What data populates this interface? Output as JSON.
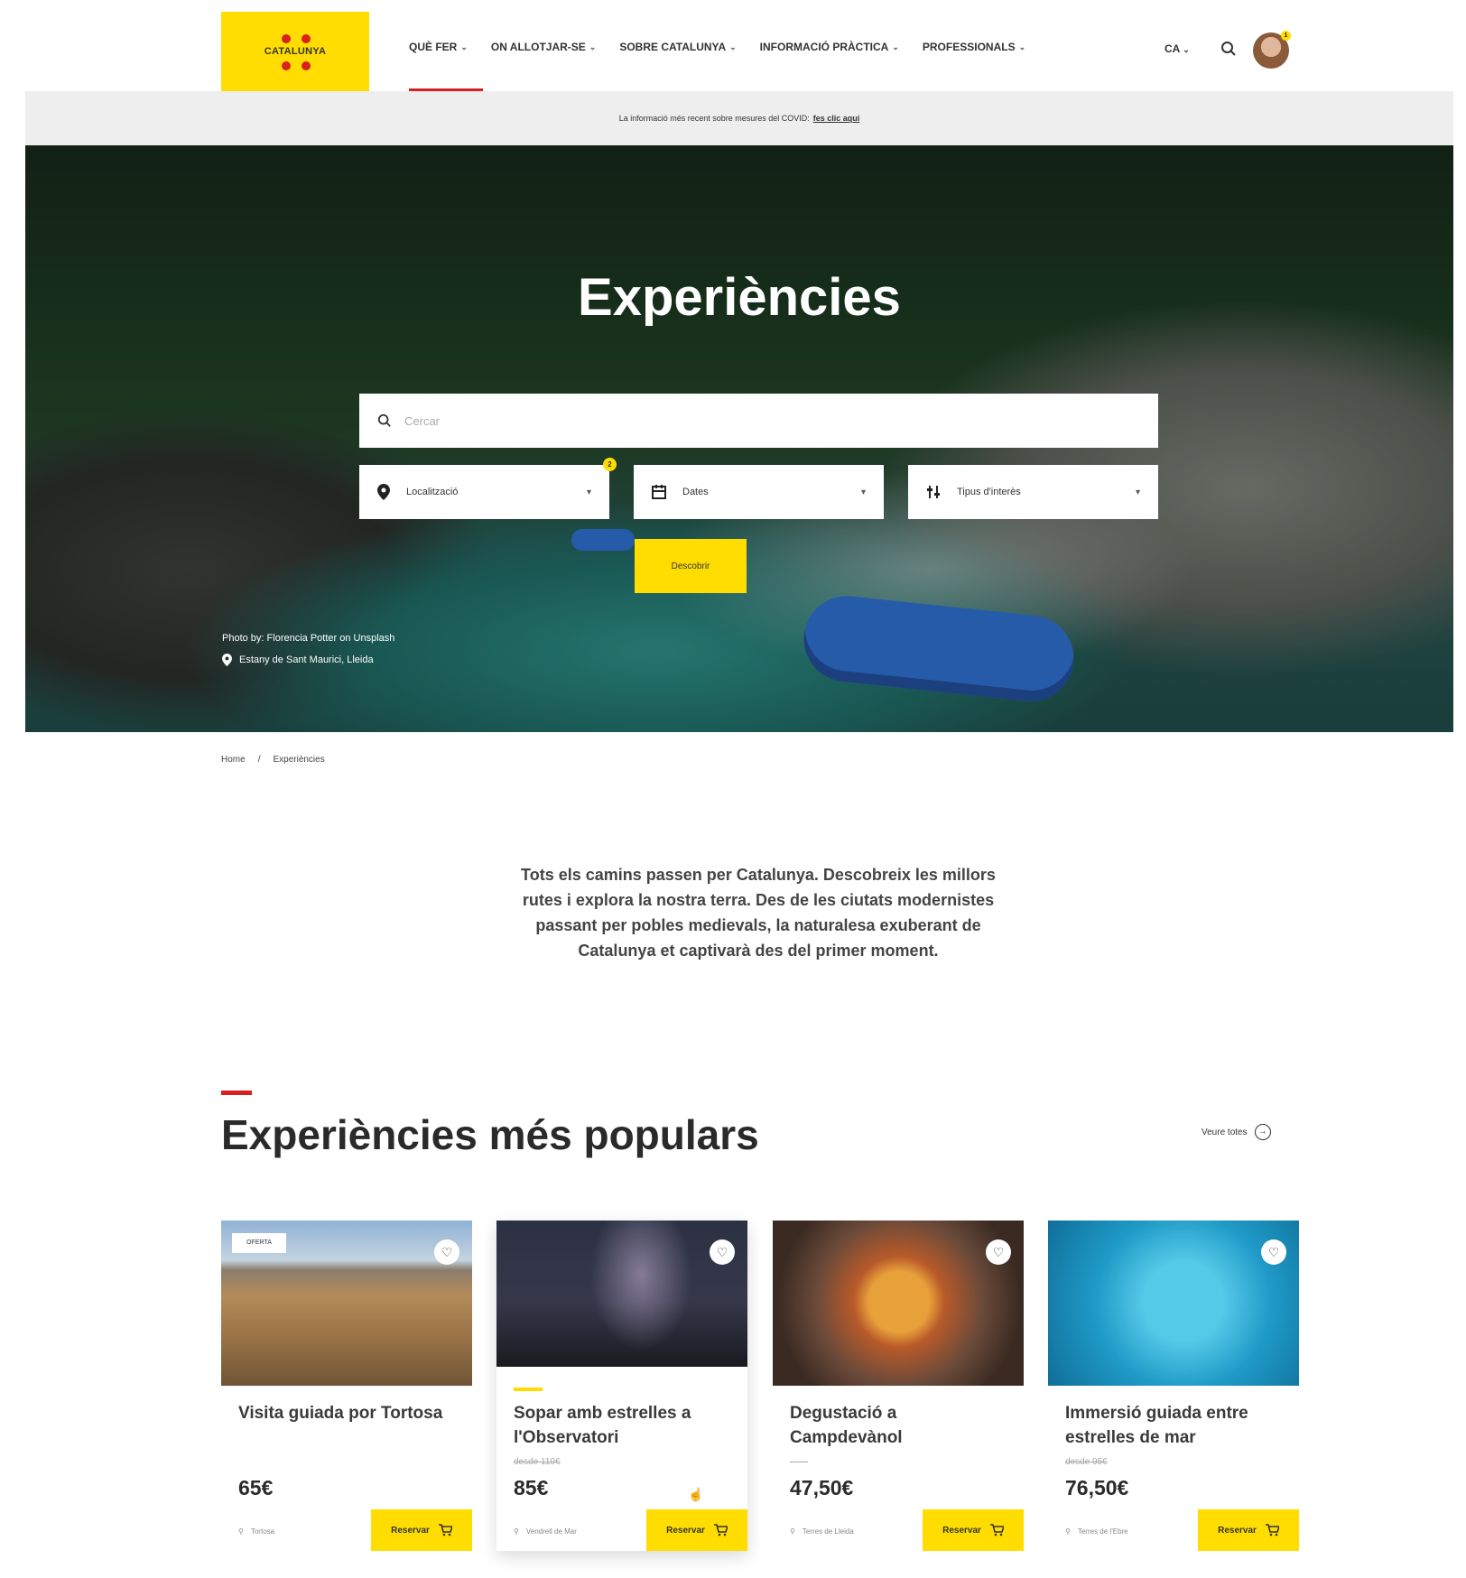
{
  "header": {
    "logo_text": "CATALUNYA",
    "nav": [
      {
        "label": "QUÈ FER"
      },
      {
        "label": "ON ALLOTJAR-SE"
      },
      {
        "label": "SOBRE CATALUNYA"
      },
      {
        "label": "INFORMACIÓ PRÀCTICA"
      },
      {
        "label": "PROFESSIONALS"
      }
    ],
    "lang": "CA",
    "avatar_badge": "1"
  },
  "notice": {
    "text": "La informació més recent sobre mesures del COVID:",
    "link": "fes clic aquí"
  },
  "hero": {
    "title": "Experiències",
    "search_placeholder": "Cercar",
    "filters": [
      {
        "label": "Localització",
        "icon": "pin-icon"
      },
      {
        "label": "Dates",
        "icon": "calendar-icon"
      },
      {
        "label": "Tipus d'interès",
        "icon": "sliders-icon"
      }
    ],
    "filter_badge": "2",
    "discover_label": "Descobrir",
    "credit": "Photo by: Florencia Potter on Unsplash",
    "place": "Estany de Sant Maurici, Lleida"
  },
  "breadcrumb": {
    "home": "Home",
    "separator": "/",
    "current": "Experiències"
  },
  "intro": "Tots els camins passen per Catalunya. Descobreix les millors rutes i explora la nostra terra. Des de les ciutats modernistes passant per pobles medievals, la naturalesa exuberant de Catalunya et captivarà des del primer moment.",
  "section": {
    "title": "Experiències més populars",
    "see_all": "Veure totes"
  },
  "cards": [
    {
      "title": "Visita guiada por Tortosa",
      "old_price": "",
      "price": "65€",
      "location": "Tortosa",
      "tag": "OFERTA",
      "reserve": "Reservar"
    },
    {
      "title": "Sopar amb estrelles a l'Observatori",
      "old_price": "desde 110€",
      "price": "85€",
      "location": "Vendrell de Mar",
      "tag": "",
      "reserve": "Reservar"
    },
    {
      "title": "Degustació a Campdevànol",
      "old_price": "——",
      "price": "47,50€",
      "location": "Terres de Lleida",
      "tag": "",
      "reserve": "Reservar"
    },
    {
      "title": "Immersió guiada entre estrelles de mar",
      "old_price": "desde 95€",
      "price": "76,50€",
      "location": "Terres de l'Ebre",
      "tag": "",
      "reserve": "Reservar"
    }
  ],
  "colors": {
    "brand_yellow": "#ffdd00",
    "accent_red": "#d8201e"
  }
}
